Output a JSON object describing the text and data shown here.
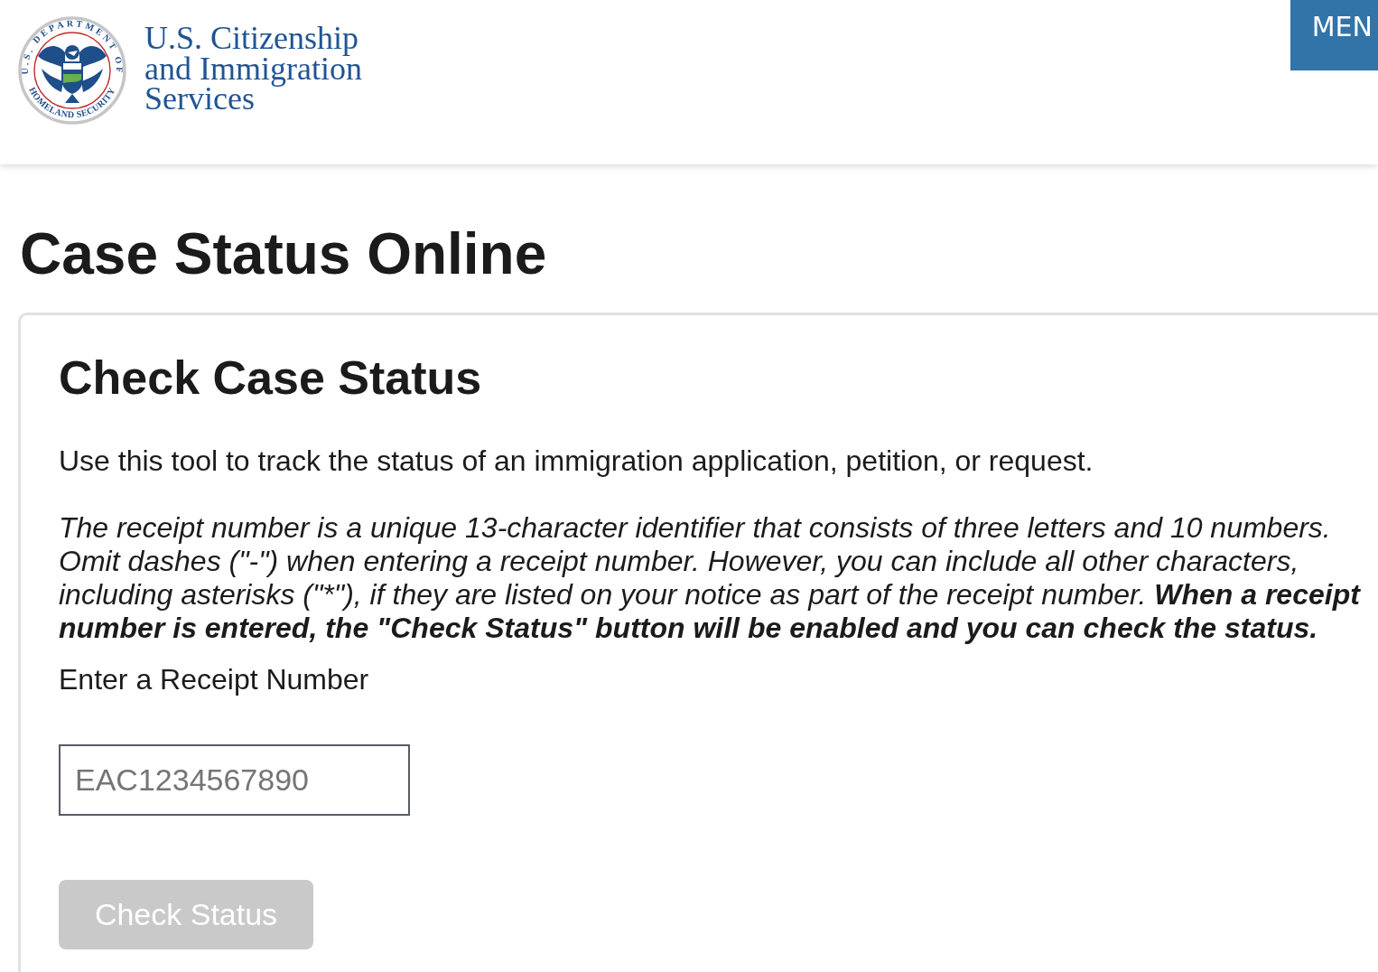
{
  "header": {
    "logo": {
      "seal_top": "U.S. DEPARTMENT OF",
      "seal_bottom": "HOMELAND SECURITY",
      "agency_lines": [
        "U.S. Citizenship",
        "and Immigration",
        "Services"
      ]
    },
    "menu_button": {
      "label": "MEN"
    }
  },
  "page_title": "Case Status Online",
  "card": {
    "title": "Check Case Status",
    "intro": "Use this tool to track the status of an immigration application, petition, or request.",
    "note": {
      "text": "The receipt number is a unique 13-character identifier that consists of three letters and 10 numbers. Omit dashes (\"-\") when entering a receipt number. However, you can include all other characters, including asterisks (\"*\"), if they are listed on your notice as part of the receipt number.",
      "emphasis": "When a receipt number is entered, the \"Check Status\" button will be enabled and you can check the status."
    },
    "field": {
      "label": "Enter a Receipt Number",
      "placeholder": "EAC1234567890"
    },
    "button": {
      "label": "Check Status",
      "disabled": true
    }
  }
}
